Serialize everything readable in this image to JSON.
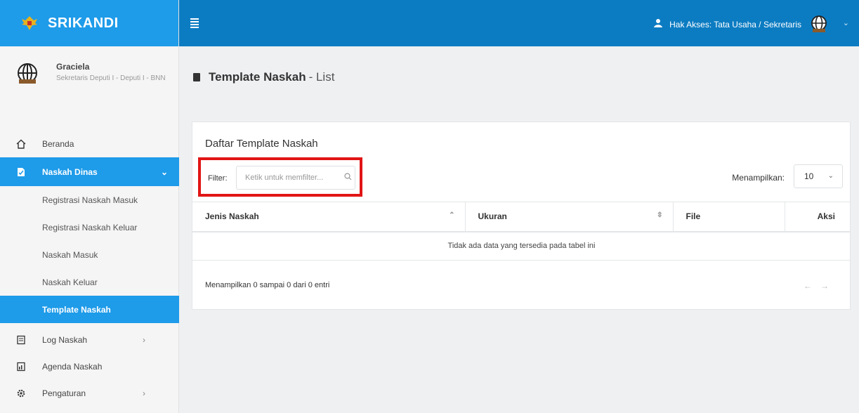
{
  "app": {
    "name": "SRIKANDI"
  },
  "user": {
    "name": "Graciela",
    "role": "Sekretaris Deputi I - Deputi I - BNN"
  },
  "topbar": {
    "access_label": "Hak Akses: Tata Usaha / Sekretaris"
  },
  "nav": {
    "beranda": "Beranda",
    "naskah_dinas": "Naskah Dinas",
    "sub": [
      "Registrasi Naskah Masuk",
      "Registrasi Naskah Keluar",
      "Naskah Masuk",
      "Naskah Keluar",
      "Template Naskah"
    ],
    "log_naskah": "Log Naskah",
    "agenda_naskah": "Agenda Naskah",
    "pengaturan": "Pengaturan"
  },
  "page": {
    "title_strong": "Template Naskah",
    "title_rest": "- List"
  },
  "card": {
    "title": "Daftar Template Naskah",
    "filter_label": "Filter:",
    "filter_placeholder": "Ketik untuk memfilter...",
    "show_label": "Menampilkan:",
    "show_value": "10",
    "columns": [
      "Jenis Naskah",
      "Ukuran",
      "File",
      "Aksi"
    ],
    "empty_text": "Tidak ada data yang tersedia pada tabel ini",
    "info_text": "Menampilkan 0 sampai 0 dari 0 entri",
    "pager_prev": "←",
    "pager_next": "→"
  },
  "colors": {
    "brand": "#1e9be9",
    "topbar": "#0c7cc2",
    "highlight": "#e11515"
  },
  "icons": [
    "menu-icon",
    "user-access-icon",
    "globe-icon",
    "home-icon",
    "document-icon",
    "log-icon",
    "agenda-icon",
    "settings-icon",
    "search-icon",
    "book-icon"
  ]
}
